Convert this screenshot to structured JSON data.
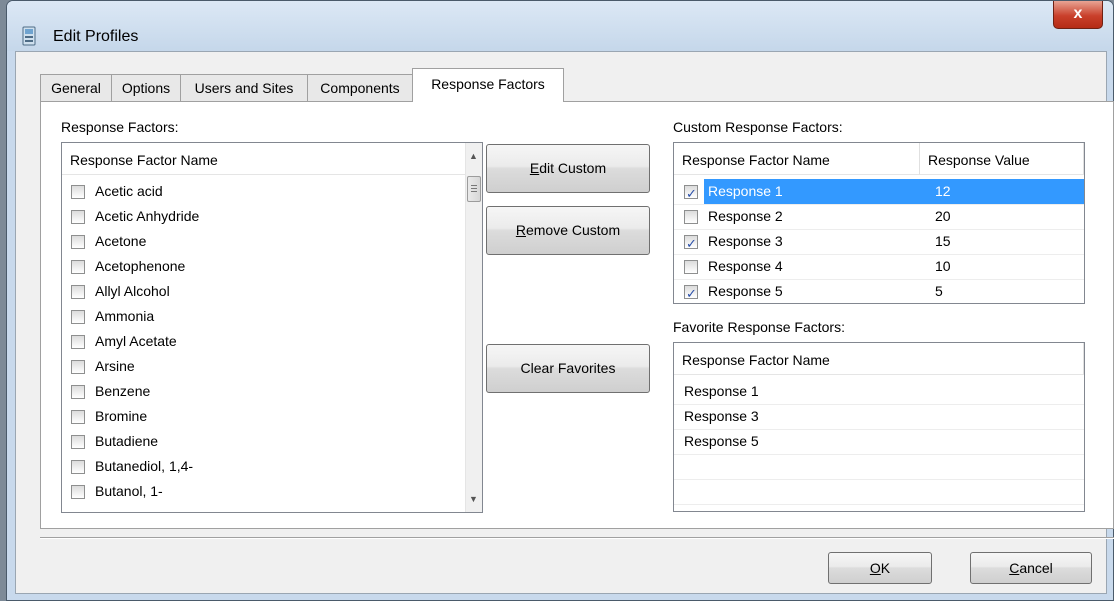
{
  "window": {
    "title": "Edit Profiles",
    "close_label": "x"
  },
  "tabs": [
    "General",
    "Options",
    "Users and Sites",
    "Components",
    "Response Factors"
  ],
  "active_tab": "Response Factors",
  "response_factors": {
    "label": "Response Factors:",
    "column": "Response Factor Name",
    "items": [
      "Acetic acid",
      "Acetic Anhydride",
      "Acetone",
      "Acetophenone",
      "Allyl Alcohol",
      "Ammonia",
      "Amyl Acetate",
      "Arsine",
      "Benzene",
      "Bromine",
      "Butadiene",
      "Butanediol, 1,4-",
      "Butanol, 1-"
    ]
  },
  "buttons": {
    "edit_custom": {
      "ul": "E",
      "rest": "dit Custom"
    },
    "remove_custom": {
      "ul": "R",
      "rest": "emove Custom"
    },
    "clear_favorites": "Clear Favorites",
    "ok": {
      "ul": "O",
      "rest": "K"
    },
    "cancel": {
      "ul": "C",
      "rest": "ancel"
    }
  },
  "custom_response_factors": {
    "label": "Custom Response Factors:",
    "columns": [
      "Response Factor Name",
      "Response Value"
    ],
    "rows": [
      {
        "name": "Response 1",
        "value": "12",
        "checked": true,
        "selected": true
      },
      {
        "name": "Response 2",
        "value": "20",
        "checked": false,
        "selected": false
      },
      {
        "name": "Response 3",
        "value": "15",
        "checked": true,
        "selected": false
      },
      {
        "name": "Response 4",
        "value": "10",
        "checked": false,
        "selected": false
      },
      {
        "name": "Response 5",
        "value": "5",
        "checked": true,
        "selected": false
      }
    ]
  },
  "favorite_response_factors": {
    "label": "Favorite Response Factors:",
    "column": "Response Factor Name",
    "items": [
      "Response 1",
      "Response 3",
      "Response 5"
    ]
  },
  "colors": {
    "selection": "#3399ff",
    "window_frame": "#c8d9ec",
    "close_button": "#c9402b"
  }
}
